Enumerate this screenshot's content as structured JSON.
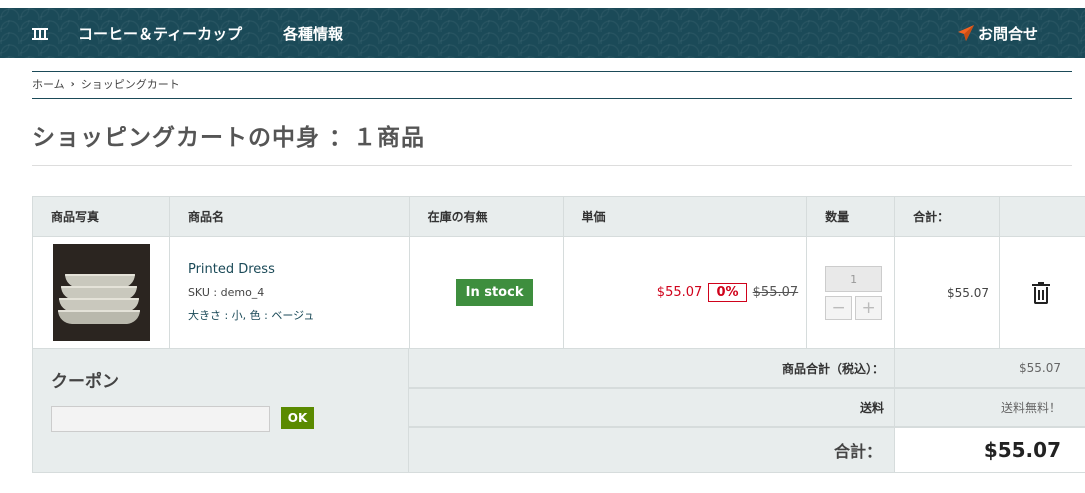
{
  "header": {
    "home_icon": "plate-icon",
    "nav_items": [
      "コーヒー＆ティーカップ",
      "各種情報"
    ],
    "contact_label": "お問合せ",
    "contact_icon": "paper-plane-icon",
    "brand_color": "#1b4a58",
    "accent_color": "#f26322"
  },
  "breadcrumb": {
    "home": "ホーム",
    "current": "ショッピングカート"
  },
  "page_title": "ショッピングカートの中身 ：１商品",
  "cart": {
    "columns": [
      "商品写真",
      "商品名",
      "在庫の有無",
      "単価",
      "数量",
      "合計："
    ],
    "items": [
      {
        "name": "Printed Dress",
        "sku": "SKU : demo_4",
        "attributes": "大きさ : 小, 色 : ベージュ",
        "stock": "In stock",
        "price_now": "$55.07",
        "discount": "0%",
        "price_old": "$55.07",
        "quantity": "1",
        "qty_minus": "−",
        "qty_plus": "+",
        "total": "$55.07",
        "delete_icon": "trash-icon"
      }
    ]
  },
  "coupon": {
    "title": "クーポン",
    "input_value": "",
    "button_label": "OK"
  },
  "summary": {
    "subtotal_label": "商品合計（税込）：",
    "subtotal_value": "$55.07",
    "shipping_label": "送料",
    "shipping_value": "送料無料！",
    "total_label": "合計：",
    "total_value": "$55.07"
  }
}
